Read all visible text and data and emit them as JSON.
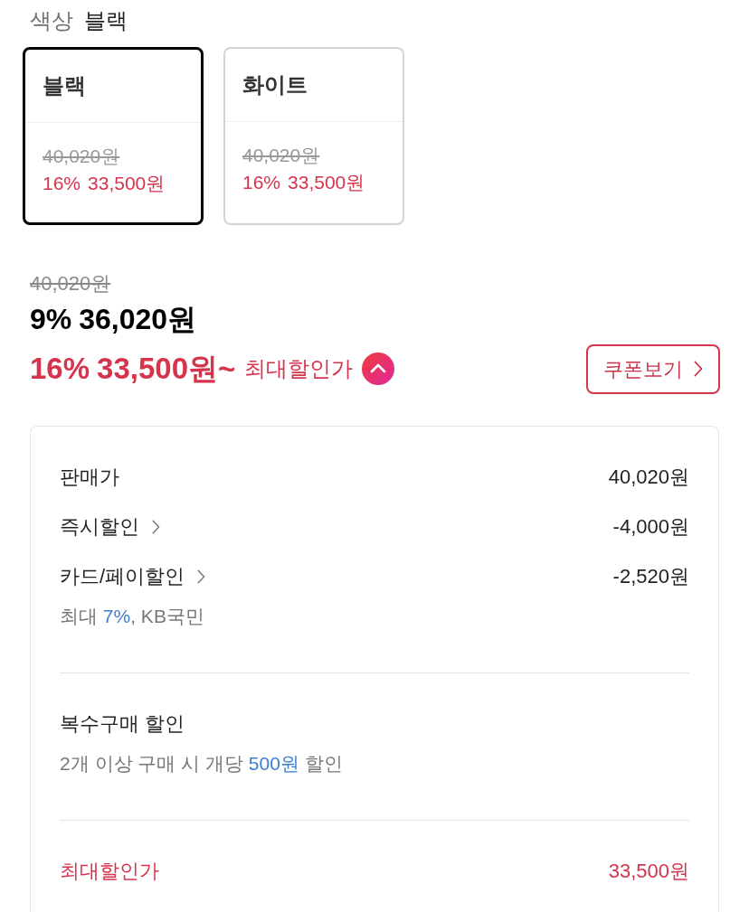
{
  "color_option": {
    "label": "색상",
    "value": "블랙"
  },
  "color_choices": [
    {
      "name": "블랙",
      "original_price": "40,020원",
      "discount": "16%",
      "sale_price": "33,500원",
      "selected": true
    },
    {
      "name": "화이트",
      "original_price": "40,020원",
      "discount": "16%",
      "sale_price": "33,500원",
      "selected": false
    }
  ],
  "price": {
    "original_price": "40,020원",
    "discount": "9%",
    "current_price": "36,020원",
    "max_discount": "16%",
    "max_price": "33,500원~",
    "max_label": "최대할인가",
    "expanded": true
  },
  "coupon_button": {
    "label": "쿠폰보기"
  },
  "breakdown": {
    "sections": [
      {
        "rows": [
          {
            "kind": "item",
            "label": "판매가",
            "linked": false,
            "amount": "40,020원"
          },
          {
            "kind": "item",
            "label": "즉시할인",
            "linked": true,
            "amount": "-4,000원"
          },
          {
            "kind": "item",
            "label": "카드/페이할인",
            "linked": true,
            "amount": "-2,520원",
            "note": "최대 **7%**, KB국민"
          }
        ]
      },
      {
        "rows": [
          {
            "kind": "item",
            "label": "복수구매 할인",
            "linked": false,
            "note": "2개 이상 구매 시 개당 **500원** 할인"
          }
        ]
      },
      {
        "rows": [
          {
            "kind": "total",
            "label": "최대할인가",
            "amount": "33,500원"
          }
        ]
      }
    ]
  }
}
